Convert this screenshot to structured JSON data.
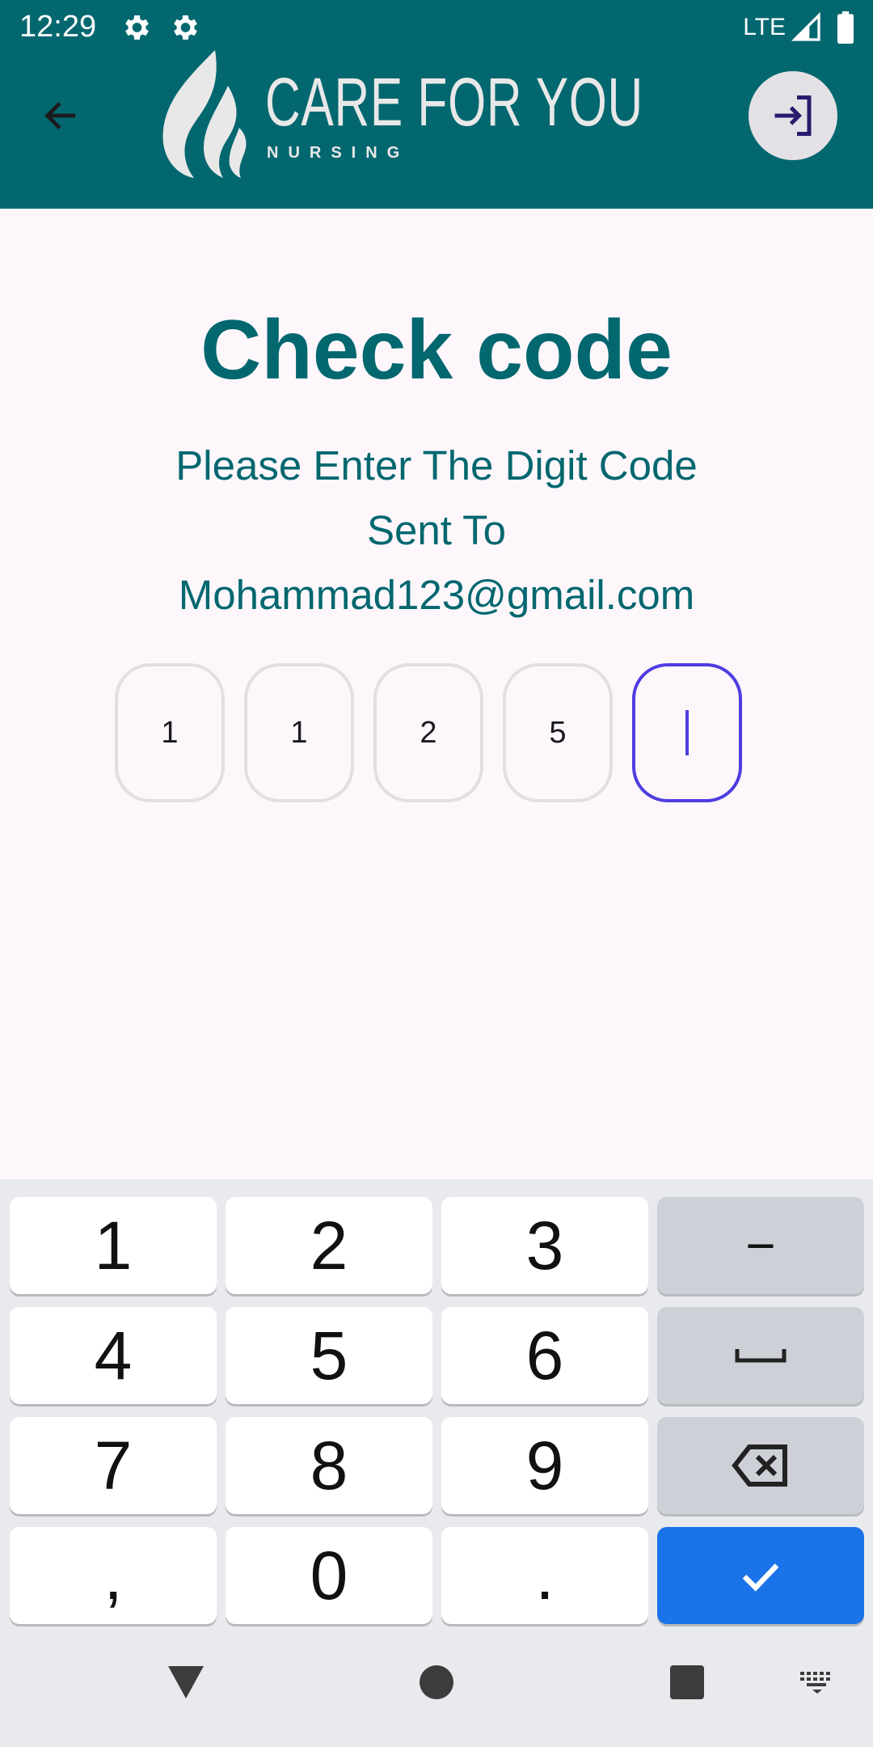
{
  "status_bar": {
    "time": "12:29",
    "network": "LTE",
    "icons": [
      "gear-icon",
      "gear-icon",
      "signal-icon",
      "battery-icon"
    ]
  },
  "app_bar": {
    "back_icon": "arrow-left-icon",
    "logo": {
      "title": "CARE FOR YOU",
      "subtitle": "NURSING"
    },
    "login_icon": "login-icon"
  },
  "main": {
    "title": "Check code",
    "instruction_lines": [
      "Please Enter The Digit Code",
      "Sent To",
      "Mohammad123@gmail.com"
    ],
    "code_digits": [
      "1",
      "1",
      "2",
      "5",
      ""
    ],
    "active_index": 4
  },
  "keyboard": {
    "rows": [
      [
        "1",
        "2",
        "3",
        "−"
      ],
      [
        "4",
        "5",
        "6",
        "space"
      ],
      [
        "7",
        "8",
        "9",
        "backspace"
      ],
      [
        ",",
        "0",
        ".",
        "done"
      ]
    ]
  },
  "nav_bar": {
    "icons": [
      "back-triangle-icon",
      "home-circle-icon",
      "recents-square-icon",
      "keyboard-switch-icon"
    ]
  },
  "colors": {
    "primary": "#02676f",
    "accent": "#4d3de0",
    "background": "#fdf7fb",
    "keyboard_enter": "#1a73e8"
  }
}
